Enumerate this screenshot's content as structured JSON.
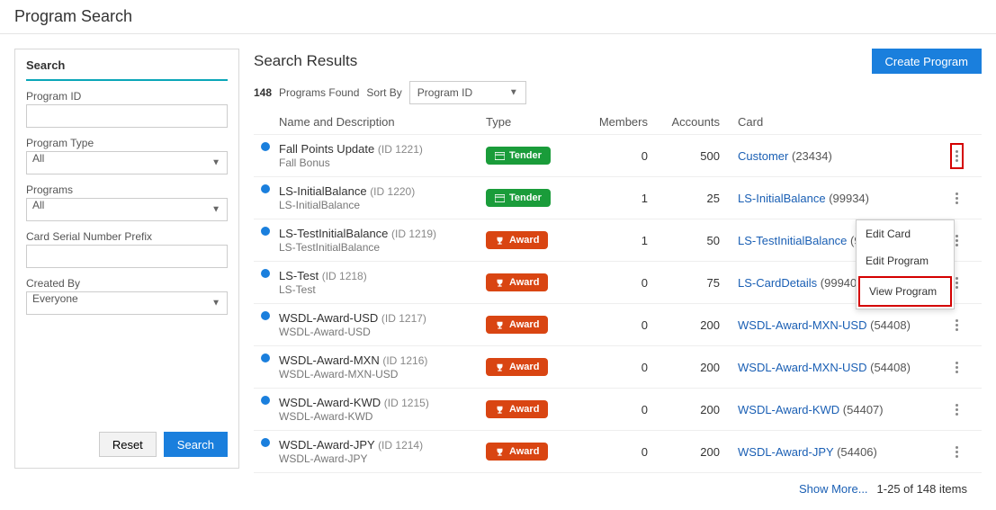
{
  "page": {
    "title": "Program Search"
  },
  "search": {
    "heading": "Search",
    "program_id_label": "Program ID",
    "program_id_value": "",
    "program_type_label": "Program Type",
    "program_type_value": "All",
    "programs_label": "Programs",
    "programs_value": "All",
    "card_serial_label": "Card Serial Number Prefix",
    "card_serial_value": "",
    "created_by_label": "Created By",
    "created_by_value": "Everyone",
    "reset_label": "Reset",
    "search_label": "Search"
  },
  "results": {
    "heading": "Search Results",
    "create_label": "Create Program",
    "count": "148",
    "found_label": "Programs Found",
    "sort_by_label": "Sort By",
    "sort_by_value": "Program ID",
    "columns": {
      "name": "Name and Description",
      "type": "Type",
      "members": "Members",
      "accounts": "Accounts",
      "card": "Card"
    },
    "rows": [
      {
        "name": "Fall Points Update",
        "id": "(ID 1221)",
        "desc": "Fall Bonus",
        "type": "Tender",
        "type_kind": "tender",
        "members": "0",
        "accounts": "500",
        "card_name": "Customer",
        "card_id": "(23434)",
        "highlight_menu": true
      },
      {
        "name": "LS-InitialBalance",
        "id": "(ID 1220)",
        "desc": "LS-InitialBalance",
        "type": "Tender",
        "type_kind": "tender",
        "members": "1",
        "accounts": "25",
        "card_name": "LS-InitialBalance",
        "card_id": "(99934)"
      },
      {
        "name": "LS-TestInitialBalance",
        "id": "(ID 1219)",
        "desc": "LS-TestInitialBalance",
        "type": "Award",
        "type_kind": "award",
        "members": "1",
        "accounts": "50",
        "card_name": "LS-TestInitialBalance",
        "card_id": "(99933)"
      },
      {
        "name": "LS-Test",
        "id": "(ID 1218)",
        "desc": "LS-Test",
        "type": "Award",
        "type_kind": "award",
        "members": "0",
        "accounts": "75",
        "card_name": "LS-CardDetails",
        "card_id": "(99940)"
      },
      {
        "name": "WSDL-Award-USD",
        "id": "(ID 1217)",
        "desc": "WSDL-Award-USD",
        "type": "Award",
        "type_kind": "award",
        "members": "0",
        "accounts": "200",
        "card_name": "WSDL-Award-MXN-USD",
        "card_id": "(54408)"
      },
      {
        "name": "WSDL-Award-MXN",
        "id": "(ID 1216)",
        "desc": "WSDL-Award-MXN-USD",
        "type": "Award",
        "type_kind": "award",
        "members": "0",
        "accounts": "200",
        "card_name": "WSDL-Award-MXN-USD",
        "card_id": "(54408)"
      },
      {
        "name": "WSDL-Award-KWD",
        "id": "(ID 1215)",
        "desc": "WSDL-Award-KWD",
        "type": "Award",
        "type_kind": "award",
        "members": "0",
        "accounts": "200",
        "card_name": "WSDL-Award-KWD",
        "card_id": "(54407)"
      },
      {
        "name": "WSDL-Award-JPY",
        "id": "(ID 1214)",
        "desc": "WSDL-Award-JPY",
        "type": "Award",
        "type_kind": "award",
        "members": "0",
        "accounts": "200",
        "card_name": "WSDL-Award-JPY",
        "card_id": "(54406)"
      }
    ],
    "dropdown": {
      "edit_card": "Edit Card",
      "edit_program": "Edit Program",
      "view_program": "View Program"
    },
    "footer": {
      "show_more": "Show More...",
      "range": "1-25 of 148 items"
    }
  }
}
